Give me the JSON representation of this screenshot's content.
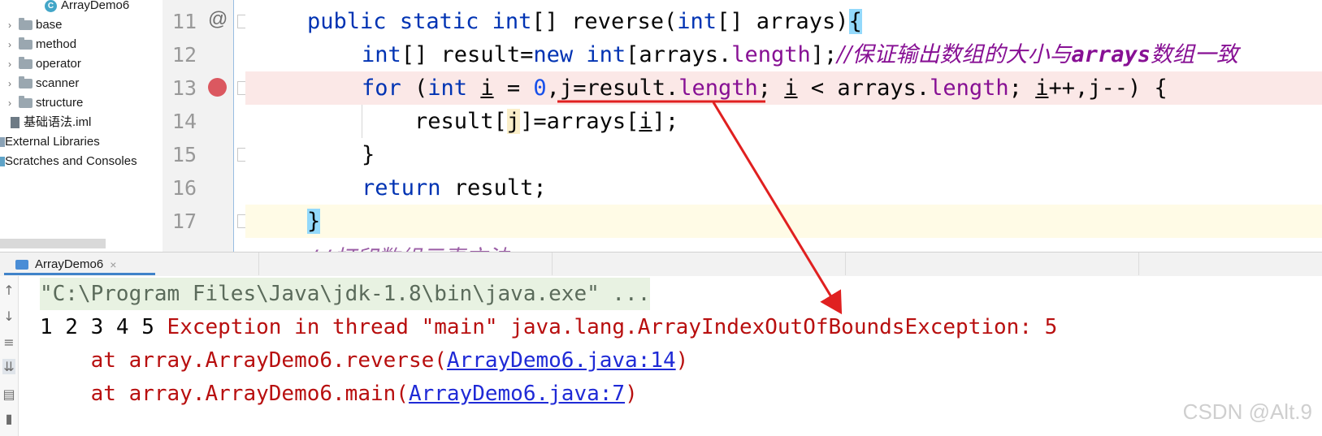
{
  "project_tree": {
    "items": [
      {
        "label": "ArrayDemo6",
        "kind": "class"
      },
      {
        "label": "base",
        "kind": "folder"
      },
      {
        "label": "method",
        "kind": "folder"
      },
      {
        "label": "operator",
        "kind": "folder"
      },
      {
        "label": "scanner",
        "kind": "folder"
      },
      {
        "label": "structure",
        "kind": "folder"
      },
      {
        "label": "基础语法.iml",
        "kind": "file"
      },
      {
        "label": "External Libraries",
        "kind": "library"
      },
      {
        "label": "Scratches and Consoles",
        "kind": "scratch"
      }
    ]
  },
  "editor": {
    "line_numbers": [
      "11",
      "12",
      "13",
      "14",
      "15",
      "16",
      "17"
    ],
    "gutter_icons": {
      "line11": "implements-at-icon",
      "line13": "breakpoint-icon"
    },
    "lines": {
      "l11": {
        "kw1": "public",
        "kw2": "static",
        "kw3": "int",
        "t1": "[] reverse(",
        "kw4": "int",
        "t2": "[] arrays)",
        "brace": "{"
      },
      "l12": {
        "kw1": "int",
        "t1": "[] result=",
        "kw2": "new",
        "kw3": "int",
        "t2": "[arrays.",
        "fld": "length",
        "t3": "];",
        "cmt1": "//保证输出数组的大小与",
        "cmt2": "arrays",
        "cmt3": "数组一致"
      },
      "l13": {
        "kw1": "for",
        "t1": " (",
        "kw2": "int",
        "v1": "i",
        "t2": " = ",
        "num": "0",
        "t3": ",",
        "v2": "j",
        "t4": "=result.",
        "fld1": "length",
        "t5": "; ",
        "v3": "i",
        "t6": " < arrays.",
        "fld2": "length",
        "t7": "; ",
        "v4": "i",
        "t8": "++,j--) {"
      },
      "l14": {
        "t1": "result[",
        "v1": "j",
        "t2": "]=arrays[",
        "v2": "i",
        "t3": "];"
      },
      "l15": {
        "t1": "}"
      },
      "l16": {
        "kw1": "return",
        "t1": " result;"
      },
      "l17": {
        "brace": "}"
      },
      "cut": "//打印数组元素方法"
    }
  },
  "tool_window": {
    "tab_label": "ArrayDemo6",
    "close_label": "×"
  },
  "console": {
    "command": "\"C:\\Program Files\\Java\\jdk-1.8\\bin\\java.exe\" ...",
    "output_numbers": "1 2 3 4 5 ",
    "exception": "Exception in thread \"main\" java.lang.ArrayIndexOutOfBoundsException: 5",
    "trace": [
      {
        "prefix": "    at array.ArrayDemo6.reverse(",
        "link": "ArrayDemo6.java:14",
        "suffix": ")"
      },
      {
        "prefix": "    at array.ArrayDemo6.main(",
        "link": "ArrayDemo6.java:7",
        "suffix": ")"
      }
    ]
  },
  "annotation_color": "#e02020",
  "watermark": "CSDN @Alt.9"
}
